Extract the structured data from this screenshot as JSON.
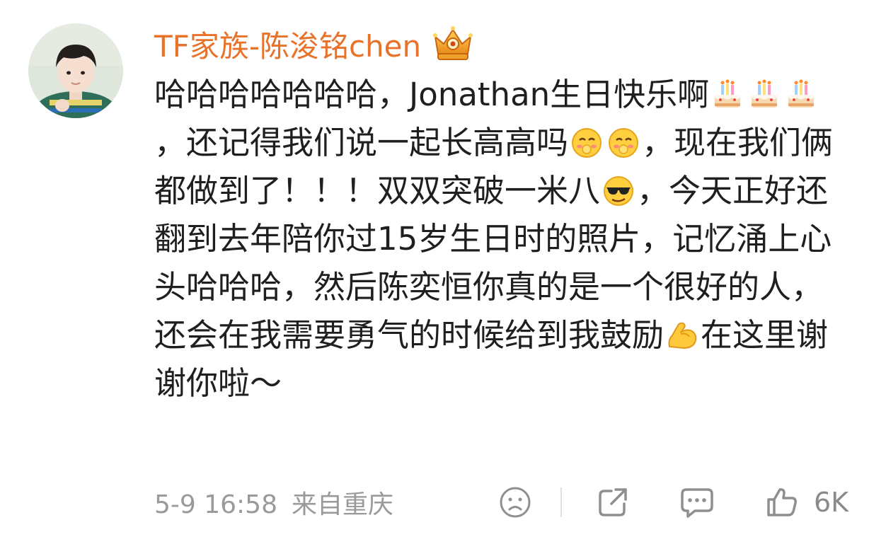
{
  "post": {
    "username": "TF家族-陈浚铭chen",
    "badge_icon": "crown-badge-icon",
    "content_segments": [
      {
        "type": "text",
        "value": "哈哈哈哈哈哈哈，Jonathan生日快乐啊"
      },
      {
        "type": "emoji",
        "name": "birthday-cake-icon"
      },
      {
        "type": "emoji",
        "name": "birthday-cake-icon"
      },
      {
        "type": "emoji",
        "name": "birthday-cake-icon"
      },
      {
        "type": "text",
        "value": "，还记得我们说一起长高高吗"
      },
      {
        "type": "emoji",
        "name": "shy-face-icon"
      },
      {
        "type": "emoji",
        "name": "shy-face-icon"
      },
      {
        "type": "text",
        "value": "，现在我们俩都做到了！！！双双突破一米八"
      },
      {
        "type": "emoji",
        "name": "cool-sunglasses-face-icon"
      },
      {
        "type": "text",
        "value": "，今天正好还翻到去年陪你过15岁生日时的照片，记忆涌上心头哈哈哈，然后陈奕恒你真的是一个很好的人，还会在我需要勇气的时候给到我鼓励"
      },
      {
        "type": "emoji",
        "name": "flexed-biceps-icon"
      },
      {
        "type": "text",
        "value": "在这里谢谢你啦～"
      }
    ],
    "timestamp": "5-9 16:58",
    "location": "来自重庆",
    "like_count": "6K"
  },
  "icons": {
    "react": "sad-face-reaction-icon",
    "share": "share-icon",
    "comment": "comment-icon",
    "like": "thumbs-up-icon"
  },
  "colors": {
    "username": "#e8722a",
    "text": "#1f1f1f",
    "meta": "#9a9a9a"
  }
}
